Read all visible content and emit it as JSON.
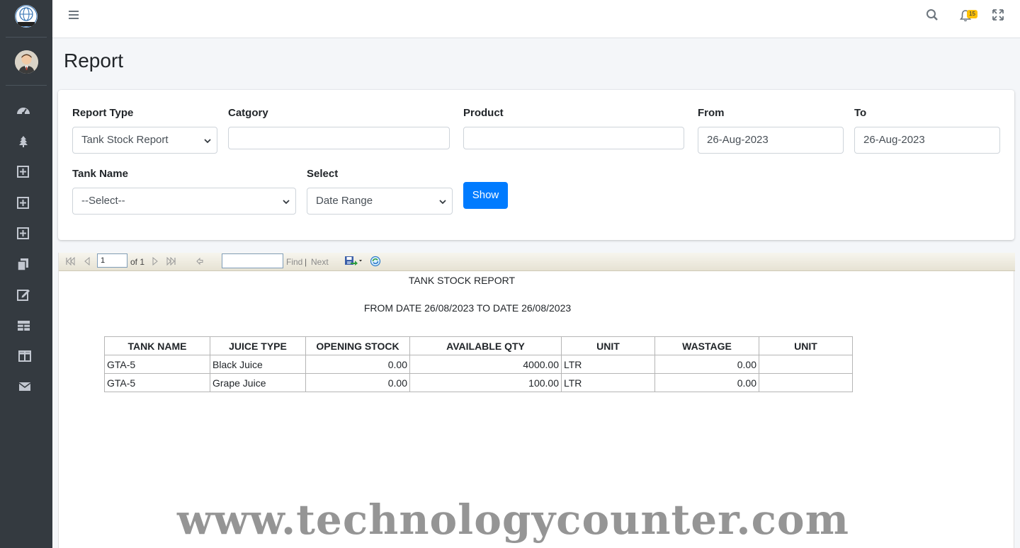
{
  "header": {
    "notification_count": "15"
  },
  "page": {
    "title": "Report"
  },
  "form": {
    "report_type_label": "Report Type",
    "report_type_value": "Tank Stock Report",
    "category_label": "Catgory",
    "category_value": "",
    "product_label": "Product",
    "product_value": "",
    "from_label": "From",
    "from_value": "26-Aug-2023",
    "to_label": "To",
    "to_value": "26-Aug-2023",
    "tank_name_label": "Tank Name",
    "tank_name_value": "--Select--",
    "select_label": "Select",
    "select_value": "Date Range",
    "show_button": "Show"
  },
  "viewer": {
    "page_number": "1",
    "page_of": "of 1",
    "find_label": "Find",
    "separator": "|",
    "next_label": "Next"
  },
  "report": {
    "title": "TANK STOCK REPORT",
    "subtitle": "FROM DATE 26/08/2023 TO DATE 26/08/2023",
    "columns": [
      "TANK NAME",
      "JUICE TYPE",
      "OPENING STOCK",
      "AVAILABLE QTY",
      "UNIT",
      "WASTAGE",
      "UNIT"
    ],
    "rows": [
      [
        "GTA-5",
        "Black Juice",
        "0.00",
        "4000.00",
        "LTR",
        "0.00",
        ""
      ],
      [
        "GTA-5",
        "Grape Juice",
        "0.00",
        "100.00",
        "LTR",
        "0.00",
        ""
      ]
    ]
  },
  "watermark": "www.technologycounter.com",
  "icons": {
    "sidebar": [
      "dashboard-icon",
      "tree-icon",
      "plus-square-icon",
      "plus-square-icon",
      "plus-square-icon",
      "copy-icon",
      "edit-icon",
      "table-icon",
      "columns-icon",
      "envelope-icon"
    ],
    "navbar": [
      "menu-icon",
      "search-icon",
      "bell-icon",
      "expand-icon"
    ]
  },
  "colors": {
    "sidebar": "#343a40",
    "primary": "#007bff",
    "badge": "#ffc107"
  }
}
